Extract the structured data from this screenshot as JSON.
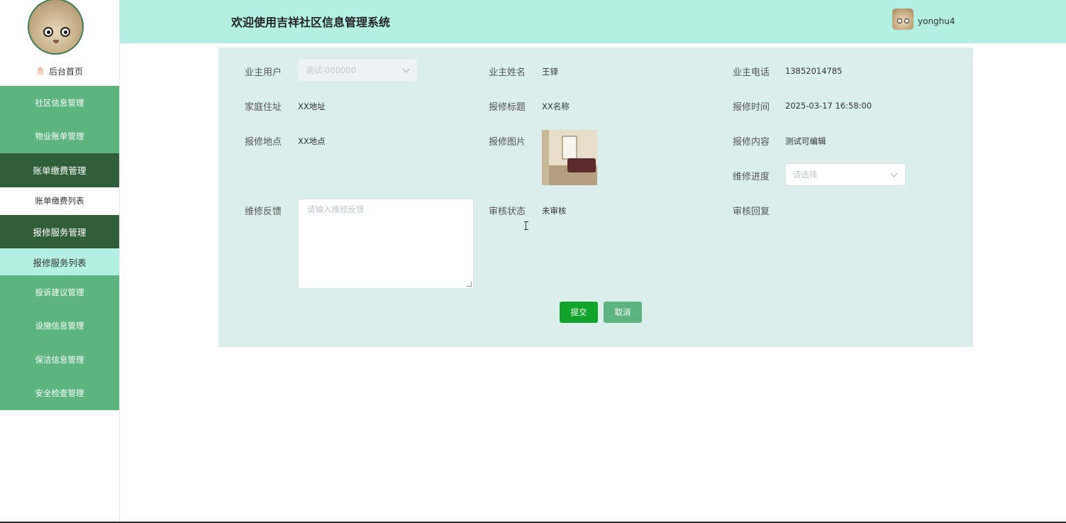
{
  "header": {
    "title": "欢迎使用吉祥社区信息管理系统",
    "username": "yonghu4"
  },
  "sidebar": {
    "home_label": "后台首页",
    "menu": [
      {
        "label": "社区信息管理"
      },
      {
        "label": "物业账单管理"
      },
      {
        "label": "账单缴费管理"
      },
      {
        "label": "账单缴费列表"
      },
      {
        "label": "报修服务管理"
      },
      {
        "label": "报修服务列表"
      },
      {
        "label": "投诉建议管理"
      },
      {
        "label": "设施信息管理"
      },
      {
        "label": "保洁信息管理"
      },
      {
        "label": "安全检查管理"
      }
    ]
  },
  "form": {
    "owner_user": {
      "label": "业主用户",
      "value": "测试-000000"
    },
    "owner_name": {
      "label": "业主姓名",
      "value": "王铎"
    },
    "owner_phone": {
      "label": "业主电话",
      "value": "13852014785"
    },
    "home_address": {
      "label": "家庭住址",
      "value": "XX地址"
    },
    "repair_title": {
      "label": "报修标题",
      "value": "XX名称"
    },
    "repair_time": {
      "label": "报修时间",
      "value": "2025-03-17 16:58:00"
    },
    "repair_location": {
      "label": "报修地点",
      "value": "XX地点"
    },
    "repair_image": {
      "label": "报修图片"
    },
    "repair_content": {
      "label": "报修内容",
      "value": "测试可编辑"
    },
    "repair_progress": {
      "label": "维修进度",
      "placeholder": "请选择"
    },
    "repair_feedback": {
      "label": "维修反馈",
      "placeholder": "请输入维修反馈"
    },
    "review_status": {
      "label": "审核状态",
      "value": "未审核"
    },
    "review_reply": {
      "label": "审核回复"
    },
    "submit_label": "提交",
    "cancel_label": "取消"
  },
  "colors": {
    "header_bg": "#b3f0e3",
    "panel_bg": "#dbeeeb",
    "menu_green": "#5cb57e",
    "menu_dark": "#2f5e39",
    "submit_green": "#10a42a"
  }
}
